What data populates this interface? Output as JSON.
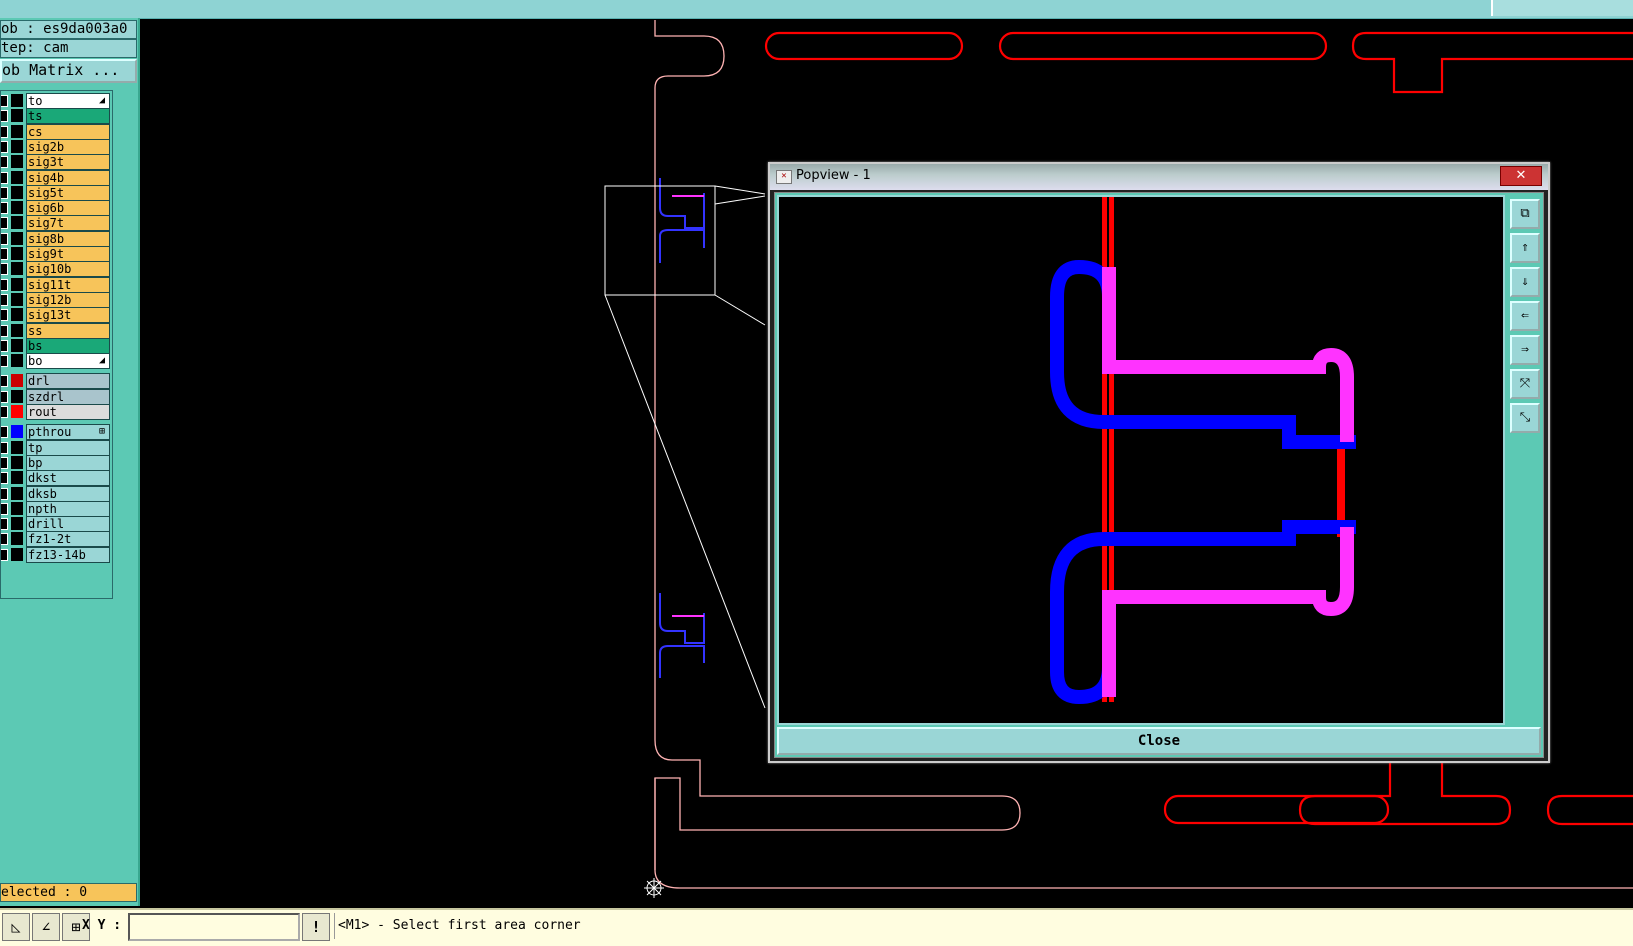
{
  "header": {
    "job": "ob : es9da003a0",
    "step": "tep: cam",
    "job_matrix": "ob Matrix ..."
  },
  "layers": [
    {
      "name": "to",
      "color": "#ffffff",
      "swatch": "#000000",
      "arrow": "◢"
    },
    {
      "name": "ts",
      "color": "#1aa878",
      "swatch": "#000000"
    },
    {
      "name": "cs",
      "color": "#f7c45a",
      "swatch": "#000000"
    },
    {
      "name": "sig2b",
      "color": "#f7c45a",
      "swatch": "#000000"
    },
    {
      "name": "sig3t",
      "color": "#f7c45a",
      "swatch": "#000000"
    },
    {
      "name": "sig4b",
      "color": "#f7c45a",
      "swatch": "#000000"
    },
    {
      "name": "sig5t",
      "color": "#f7c45a",
      "swatch": "#000000"
    },
    {
      "name": "sig6b",
      "color": "#f7c45a",
      "swatch": "#000000"
    },
    {
      "name": "sig7t",
      "color": "#f7c45a",
      "swatch": "#000000"
    },
    {
      "name": "sig8b",
      "color": "#f7c45a",
      "swatch": "#000000"
    },
    {
      "name": "sig9t",
      "color": "#f7c45a",
      "swatch": "#000000"
    },
    {
      "name": "sig10b",
      "color": "#f7c45a",
      "swatch": "#000000"
    },
    {
      "name": "sig11t",
      "color": "#f7c45a",
      "swatch": "#000000"
    },
    {
      "name": "sig12b",
      "color": "#f7c45a",
      "swatch": "#000000"
    },
    {
      "name": "sig13t",
      "color": "#f7c45a",
      "swatch": "#000000"
    },
    {
      "name": "ss",
      "color": "#f7c45a",
      "swatch": "#000000"
    },
    {
      "name": "bs",
      "color": "#1aa878",
      "swatch": "#000000"
    },
    {
      "name": "bo",
      "color": "#ffffff",
      "swatch": "#000000",
      "arrow": "◢"
    },
    {
      "name": "drl",
      "color": "#a9c4cc",
      "swatch": "#cc0000"
    },
    {
      "name": "szdrl",
      "color": "#a9c4cc",
      "swatch": "#000000"
    },
    {
      "name": "rout",
      "color": "#dcdcdc",
      "swatch": "#ff0000"
    },
    {
      "name": "pthrou",
      "color": "#9ad6d6",
      "swatch": "#0000ff",
      "arrow": "⊞"
    },
    {
      "name": "tp",
      "color": "#9ad6d6",
      "swatch": "#000000"
    },
    {
      "name": "bp",
      "color": "#9ad6d6",
      "swatch": "#000000"
    },
    {
      "name": "dkst",
      "color": "#9ad6d6",
      "swatch": "#000000"
    },
    {
      "name": "dksb",
      "color": "#9ad6d6",
      "swatch": "#000000"
    },
    {
      "name": "npth",
      "color": "#9ad6d6",
      "swatch": "#000000"
    },
    {
      "name": "drill",
      "color": "#9ad6d6",
      "swatch": "#000000"
    },
    {
      "name": "fz1-2t",
      "color": "#9ad6d6",
      "swatch": "#000000"
    },
    {
      "name": "fz13-14b",
      "color": "#9ad6d6",
      "swatch": "#000000"
    }
  ],
  "selected_text": "elected : 0",
  "status": {
    "xy_label": "X Y :",
    "xy_value": "",
    "excl": "!",
    "prompt": "<M1> - Select first area corner"
  },
  "popview": {
    "title": "Popview - 1",
    "close_label": "Close",
    "close_x": "✕",
    "tools": [
      "zoom-fit-icon",
      "pan-up-icon",
      "pan-down-icon",
      "pan-left-icon",
      "pan-right-icon",
      "zoom-in-icon",
      "zoom-out-icon"
    ]
  },
  "colors": {
    "rout": "#ff0000",
    "pthrou": "#0000ff",
    "overlap": "#ff33ff",
    "outline": "#ffb3b3"
  }
}
